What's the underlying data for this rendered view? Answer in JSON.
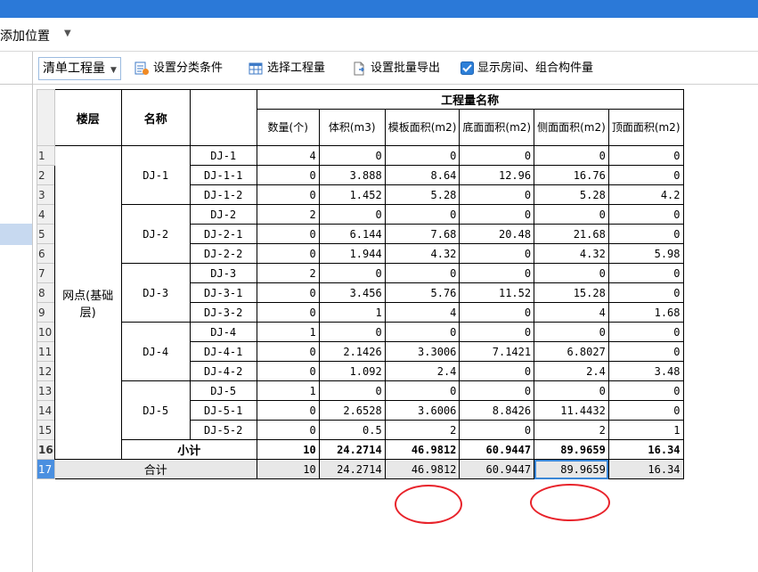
{
  "menu": {
    "add_position": "添加位置"
  },
  "toolbar": {
    "dropdown_label": "清单工程量",
    "set_category": "设置分类条件",
    "select_quantity": "选择工程量",
    "set_batch_export": "设置批量导出",
    "show_rooms": "显示房间、组合构件量",
    "show_rooms_checked": true
  },
  "grid": {
    "headers": {
      "floor": "楼层",
      "name": "名称",
      "quantity_group": "工程量名称",
      "count": "数量(个)",
      "volume": "体积(m3)",
      "formwork": "模板面积(m2)",
      "bottom": "底面面积(m2)",
      "side": "侧面面积(m2)",
      "top": "顶面面积(m2)"
    },
    "floor_value": "网点(基础层)",
    "groups": [
      {
        "name": "DJ-1",
        "rows": [
          {
            "code": "DJ-1",
            "count": "4",
            "volume": "0",
            "formwork": "0",
            "bottom": "0",
            "side": "0",
            "top": "0"
          },
          {
            "code": "DJ-1-1",
            "count": "0",
            "volume": "3.888",
            "formwork": "8.64",
            "bottom": "12.96",
            "side": "16.76",
            "top": "0"
          },
          {
            "code": "DJ-1-2",
            "count": "0",
            "volume": "1.452",
            "formwork": "5.28",
            "bottom": "0",
            "side": "5.28",
            "top": "4.2"
          }
        ]
      },
      {
        "name": "DJ-2",
        "rows": [
          {
            "code": "DJ-2",
            "count": "2",
            "volume": "0",
            "formwork": "0",
            "bottom": "0",
            "side": "0",
            "top": "0"
          },
          {
            "code": "DJ-2-1",
            "count": "0",
            "volume": "6.144",
            "formwork": "7.68",
            "bottom": "20.48",
            "side": "21.68",
            "top": "0"
          },
          {
            "code": "DJ-2-2",
            "count": "0",
            "volume": "1.944",
            "formwork": "4.32",
            "bottom": "0",
            "side": "4.32",
            "top": "5.98"
          }
        ]
      },
      {
        "name": "DJ-3",
        "rows": [
          {
            "code": "DJ-3",
            "count": "2",
            "volume": "0",
            "formwork": "0",
            "bottom": "0",
            "side": "0",
            "top": "0"
          },
          {
            "code": "DJ-3-1",
            "count": "0",
            "volume": "3.456",
            "formwork": "5.76",
            "bottom": "11.52",
            "side": "15.28",
            "top": "0"
          },
          {
            "code": "DJ-3-2",
            "count": "0",
            "volume": "1",
            "formwork": "4",
            "bottom": "0",
            "side": "4",
            "top": "1.68"
          }
        ]
      },
      {
        "name": "DJ-4",
        "rows": [
          {
            "code": "DJ-4",
            "count": "1",
            "volume": "0",
            "formwork": "0",
            "bottom": "0",
            "side": "0",
            "top": "0"
          },
          {
            "code": "DJ-4-1",
            "count": "0",
            "volume": "2.1426",
            "formwork": "3.3006",
            "bottom": "7.1421",
            "side": "6.8027",
            "top": "0"
          },
          {
            "code": "DJ-4-2",
            "count": "0",
            "volume": "1.092",
            "formwork": "2.4",
            "bottom": "0",
            "side": "2.4",
            "top": "3.48"
          }
        ]
      },
      {
        "name": "DJ-5",
        "rows": [
          {
            "code": "DJ-5",
            "count": "1",
            "volume": "0",
            "formwork": "0",
            "bottom": "0",
            "side": "0",
            "top": "0"
          },
          {
            "code": "DJ-5-1",
            "count": "0",
            "volume": "2.6528",
            "formwork": "3.6006",
            "bottom": "8.8426",
            "side": "11.4432",
            "top": "0"
          },
          {
            "code": "DJ-5-2",
            "count": "0",
            "volume": "0.5",
            "formwork": "2",
            "bottom": "0",
            "side": "2",
            "top": "1"
          }
        ]
      }
    ],
    "subtotal": {
      "label": "小计",
      "count": "10",
      "volume": "24.2714",
      "formwork": "46.9812",
      "bottom": "60.9447",
      "side": "89.9659",
      "top": "16.34"
    },
    "total": {
      "label": "合计",
      "count": "10",
      "volume": "24.2714",
      "formwork": "46.9812",
      "bottom": "60.9447",
      "side": "89.9659",
      "top": "16.34"
    },
    "row_numbers": [
      "1",
      "2",
      "3",
      "4",
      "5",
      "6",
      "7",
      "8",
      "9",
      "10",
      "11",
      "12",
      "13",
      "14",
      "15",
      "16",
      "17"
    ],
    "selected_row": "17"
  },
  "colors": {
    "title_bar": "#2b79d8",
    "selection": "#4a8fe0",
    "annotation": "#e8232b"
  }
}
